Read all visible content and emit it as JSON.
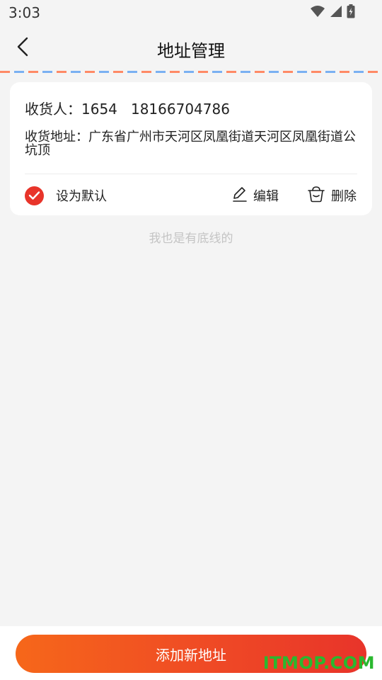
{
  "status_bar": {
    "time": "3:03",
    "icons": [
      "wifi-icon",
      "signal-icon",
      "battery-icon"
    ]
  },
  "header": {
    "title": "地址管理",
    "back_icon": "chevron-left-icon"
  },
  "address_card": {
    "receiver_line": "收货人：1654   18166704786",
    "address_line": "收货地址：广东省广州市天河区凤凰街道天河区凤凰街道公坑顶",
    "is_default": true,
    "default_label": "设为默认",
    "edit_label": "编辑",
    "delete_label": "删除"
  },
  "footer_note": "我也是有底线的",
  "add_button_label": "添加新地址",
  "watermark": "ITMOP.COM",
  "colors": {
    "accent": "#e8342a",
    "gradient_start": "#f6671a",
    "airmail_red": "#ff8a66",
    "airmail_blue": "#7ab0f2"
  }
}
